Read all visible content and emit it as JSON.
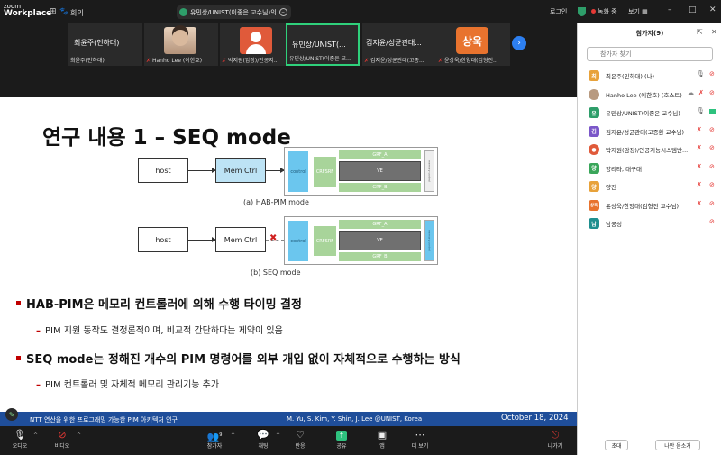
{
  "app": {
    "logo_line1": "zoom",
    "logo_line2": "Workplace"
  },
  "topbar": {
    "meeting_label": "회의",
    "speaker": "유민상/UNIST(이종은 교수님)의",
    "login": "로그인",
    "recording": "녹화 중",
    "view": "보기",
    "icons": [
      "grid-icon",
      "paw-icon",
      "shield-icon",
      "minimize-icon",
      "maximize-icon",
      "close-icon"
    ]
  },
  "video_strip": [
    {
      "name": "최윤주(인하대)",
      "sub": "최윤주(인하대)",
      "muted": false
    },
    {
      "name": "",
      "sub": "Hanho Lee (이한호)",
      "muted": true
    },
    {
      "name": "",
      "sub": "박지원(암장)/인공지...",
      "muted": true
    },
    {
      "name": "유민상/UNIST(...",
      "sub": "유민상/UNIST(이종은 교...",
      "muted": false
    },
    {
      "name": "김지윤/성균관대...",
      "sub": "김지윤/성균관대(고종...",
      "muted": true
    },
    {
      "name": "",
      "sub": "윤상욱/한양대(김형진...",
      "muted": true,
      "avatar_text": "상욱"
    }
  ],
  "slide": {
    "title": "연구 내용 1 – SEQ mode",
    "diagram": {
      "host": "host",
      "mem_ctrl": "Mem Ctrl",
      "control": "control",
      "grf_a": "GRF_A",
      "grf_b": "GRF_B",
      "crf": "CRF",
      "srf": "SRF",
      "ve": "VE",
      "mcs": "memory control",
      "caption_a": "(a) HAB-PIM mode",
      "caption_b": "(b) SEQ mode"
    },
    "bullets": [
      {
        "main": "HAB-PIM은 메모리 컨트롤러에 의해 수행 타이밍 결정",
        "sub": "PIM 지원 동작도 결정론적이며, 비교적 간단하다는 제약이 있음"
      },
      {
        "main": "SEQ mode는 정해진 개수의 PIM 명령어를 외부 개입 없이 자체적으로 수행하는 방식",
        "sub": "PIM 컨트롤러 및 자체적 메모리 관리기능 추가"
      }
    ],
    "footer": {
      "left": "NTT 연산을 위한 프로그래밍 가능한 PIM 아키텍처 연구",
      "authors": "M. Yu, S. Kim, Y. Shin, J. Lee @UNIST, Korea",
      "date": "October 18, 2024"
    }
  },
  "toolbar": {
    "audio": "오디오",
    "video": "비디오",
    "participants": "참가자",
    "participants_count": "9",
    "chat": "채팅",
    "react": "반응",
    "share": "공유",
    "apps": "앱",
    "more": "더 보기",
    "leave": "나가기"
  },
  "panel": {
    "title": "참가자(9)",
    "search_placeholder": "참가자 찾기",
    "participants": [
      {
        "name": "최윤주(인하대) (나)",
        "avatar": "최",
        "color": "#e8a23a",
        "mic": "on",
        "cam": "off"
      },
      {
        "name": "Hanho Lee (이한호) (호스트)",
        "avatar": "",
        "color": "#b89a80",
        "mic": "off",
        "cam": "off"
      },
      {
        "name": "유민상/UNIST(이종은 교수님)",
        "avatar": "유",
        "color": "#2e9e6a",
        "mic": "on",
        "cam": "on"
      },
      {
        "name": "김지윤/성균관대(고종환 교수님)",
        "avatar": "김",
        "color": "#7b57c9",
        "mic": "off",
        "cam": "off"
      },
      {
        "name": "박지원(암장)/인공지능시스템반...",
        "avatar": "",
        "color": "#e05a3a",
        "mic": "off",
        "cam": "off"
      },
      {
        "name": "양리타, 대구대",
        "avatar": "양",
        "color": "#3aa65a",
        "mic": "off",
        "cam": "off"
      },
      {
        "name": "양진",
        "avatar": "양",
        "color": "#e8a23a",
        "mic": "off",
        "cam": "off"
      },
      {
        "name": "윤상욱/한양대(김형진 교수님)",
        "avatar": "상욱",
        "color": "#e8732e",
        "mic": "off",
        "cam": "off"
      },
      {
        "name": "남궁성",
        "avatar": "남",
        "color": "#1f8f8f",
        "mic": "none",
        "cam": "off"
      }
    ],
    "invite_button": "초대",
    "mute_me_button": "나만 음소거"
  }
}
